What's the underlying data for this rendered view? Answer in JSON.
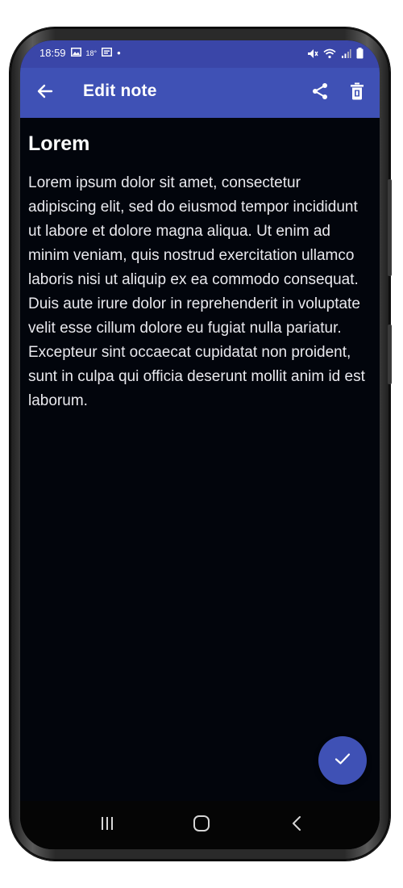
{
  "status_bar": {
    "time": "18:59",
    "temperature": "18°",
    "dot": "•",
    "icons": [
      "image-icon",
      "weather-icon",
      "notification-icon",
      "mute-icon",
      "wifi-icon",
      "signal-icon",
      "battery-icon"
    ]
  },
  "app_bar": {
    "title": "Edit note",
    "back_icon": "arrow-back-icon",
    "share_icon": "share-icon",
    "delete_icon": "delete-icon"
  },
  "note": {
    "title": "Lorem",
    "body": "Lorem ipsum dolor sit amet, consectetur adipiscing elit, sed do eiusmod tempor incididunt ut labore et dolore magna aliqua. Ut enim ad minim veniam, quis nostrud exercitation ullamco laboris nisi ut aliquip ex ea commodo consequat. Duis aute irure dolor in reprehenderit in voluptate velit esse cillum dolore eu fugiat nulla pariatur. Excepteur sint occaecat cupidatat non proident, sunt in culpa qui officia deserunt mollit anim id est laborum."
  },
  "fab": {
    "icon": "check-icon"
  },
  "nav_bar": {
    "icons": [
      "recents-icon",
      "home-icon",
      "nav-back-icon"
    ]
  },
  "colors": {
    "primary": "#3f51b5",
    "status_bar": "#3a46a8",
    "background": "#02050c",
    "text": "#e9e9ee"
  }
}
